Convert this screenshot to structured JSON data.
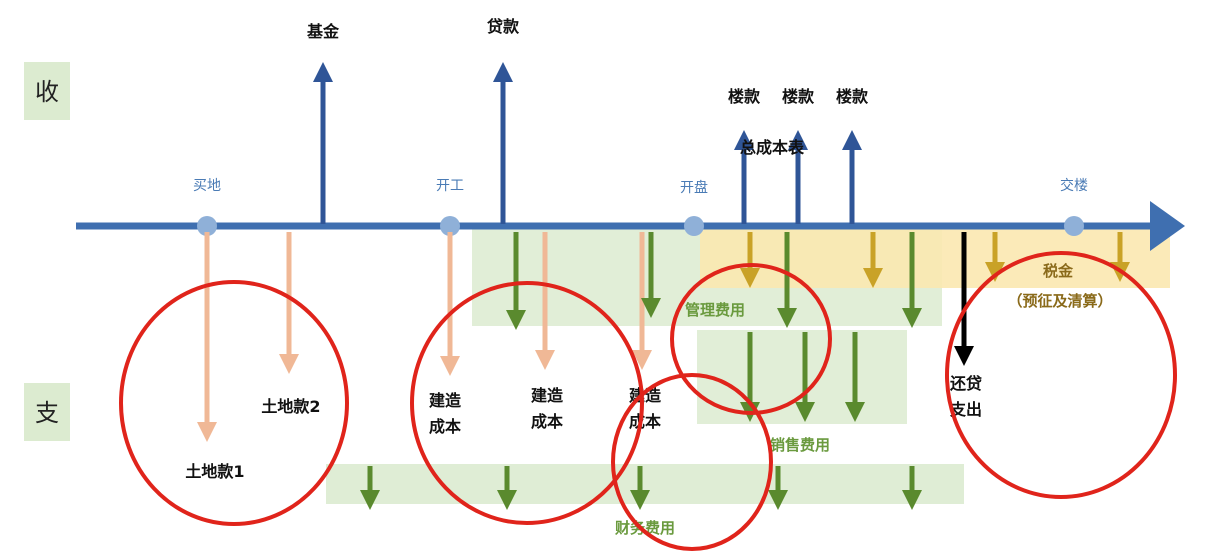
{
  "side": {
    "income": "收",
    "expense": "支"
  },
  "milestones": [
    "买地",
    "开工",
    "开盘",
    "交楼"
  ],
  "inflows": {
    "fund": "基金",
    "loan": "贷款",
    "sales": [
      "楼款",
      "楼款",
      "楼款"
    ],
    "overlay": "总成本表"
  },
  "outflows": {
    "land1": "土地款1",
    "land2": "土地款2",
    "construction": [
      [
        "建造",
        "成本"
      ],
      [
        "建造",
        "成本"
      ],
      [
        "建造",
        "成本"
      ]
    ],
    "repay": [
      "还贷",
      "支出"
    ]
  },
  "zones": {
    "mgmt": "管理费用",
    "sales": "销售费用",
    "finance": "财务费用",
    "tax": "税金",
    "tax_note": "（预征及清算）"
  },
  "colors": {
    "axis": "#3f6fb0",
    "inflow": "#2f5597",
    "land": "#f0b896",
    "green": "#5a8a2e",
    "gold": "#c9a227",
    "circle": "#e0241b",
    "zone_green": "#dcebd0",
    "zone_gold": "#fbe8b0"
  }
}
